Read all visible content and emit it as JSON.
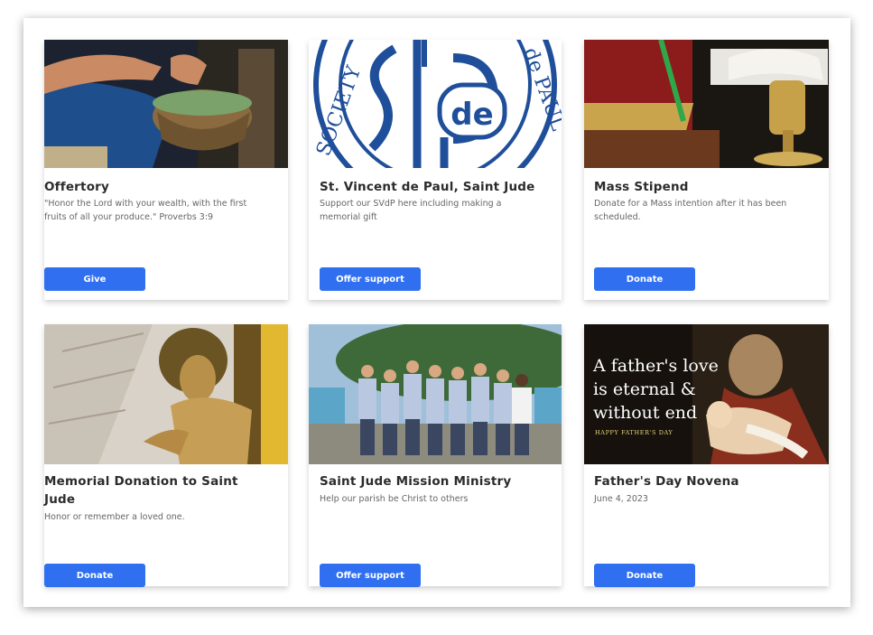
{
  "cards": [
    {
      "title": "Offertory",
      "description": "\"Honor the Lord with your wealth, with the first fruits of all your produce.\" Proverbs 3:9",
      "button": "Give",
      "image_icon": "offering-basket-photo"
    },
    {
      "title": "St. Vincent de Paul, Saint Jude",
      "description": "Support our SVdP here including making a memorial gift",
      "button": "Offer support",
      "image_icon": "svdp-logo",
      "image_text": {
        "left": "SOCIETY",
        "right": "de PAUL",
        "monogram": "de"
      }
    },
    {
      "title": "Mass Stipend",
      "description": "Donate for a Mass intention after it has been scheduled.",
      "button": "Donate",
      "image_icon": "missal-chalice-photo"
    },
    {
      "title": "Memorial Donation to Saint Jude",
      "description": "Honor or remember a loved one.",
      "button": "Donate",
      "image_icon": "crucifix-photo"
    },
    {
      "title": "Saint Jude Mission Ministry",
      "description": "Help our parish be Christ to others",
      "button": "Offer support",
      "image_icon": "mission-group-photo"
    },
    {
      "title": "Father's Day Novena",
      "description": "June 4, 2023",
      "button": "Donate",
      "image_icon": "saint-joseph-photo",
      "image_text": {
        "line1": "A father's love",
        "line2": "is eternal &",
        "line3": "without end",
        "line4": "HAPPY FATHER'S DAY"
      }
    }
  ],
  "colors": {
    "button": "#2f6ff0",
    "svdp_blue": "#1f4f9a"
  }
}
